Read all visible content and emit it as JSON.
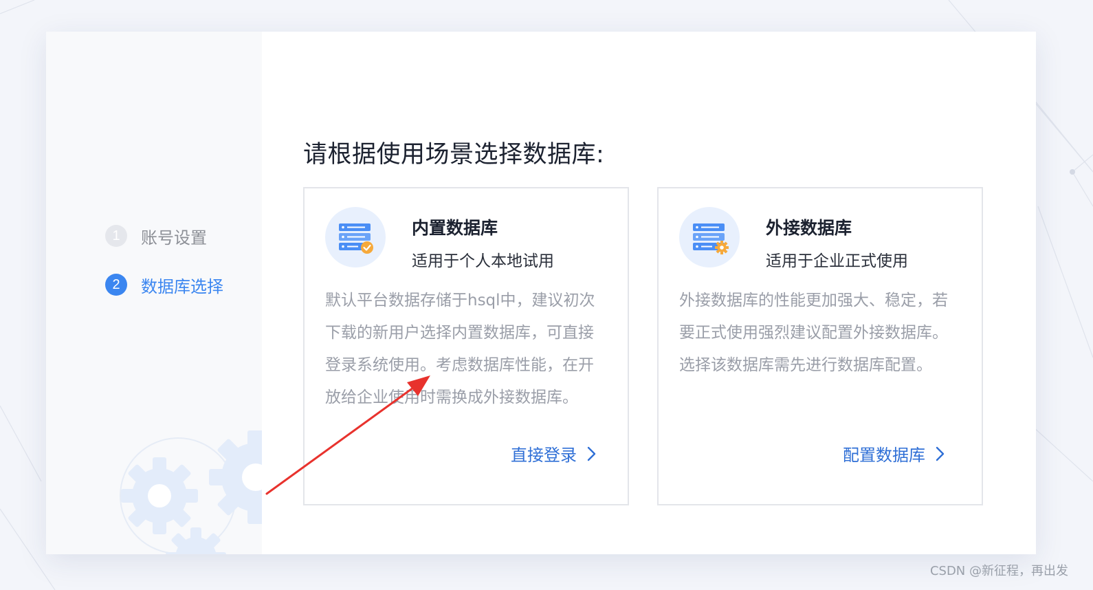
{
  "sidebar": {
    "steps": [
      {
        "number": "1",
        "label": "账号设置"
      },
      {
        "number": "2",
        "label": "数据库选择"
      }
    ]
  },
  "main": {
    "heading": "请根据使用场景选择数据库:",
    "cards": [
      {
        "title": "内置数据库",
        "subtitle": "适用于个人本地试用",
        "description": "默认平台数据存储于hsql中，建议初次下载的新用户选择内置数据库，可直接登录系统使用。考虑数据库性能，在开放给企业使用时需换成外接数据库。",
        "action": "直接登录",
        "icon": "database-server-check-icon"
      },
      {
        "title": "外接数据库",
        "subtitle": "适用于企业正式使用",
        "description": "外接数据库的性能更加强大、稳定，若要正式使用强烈建议配置外接数据库。选择该数据库需先进行数据库配置。",
        "action": "配置数据库",
        "icon": "database-server-gear-icon"
      }
    ]
  },
  "colors": {
    "accent": "#3b86f0",
    "link": "#2f6fd6",
    "annotation_arrow": "#e8322d"
  },
  "watermark": "CSDN @新征程，再出发"
}
